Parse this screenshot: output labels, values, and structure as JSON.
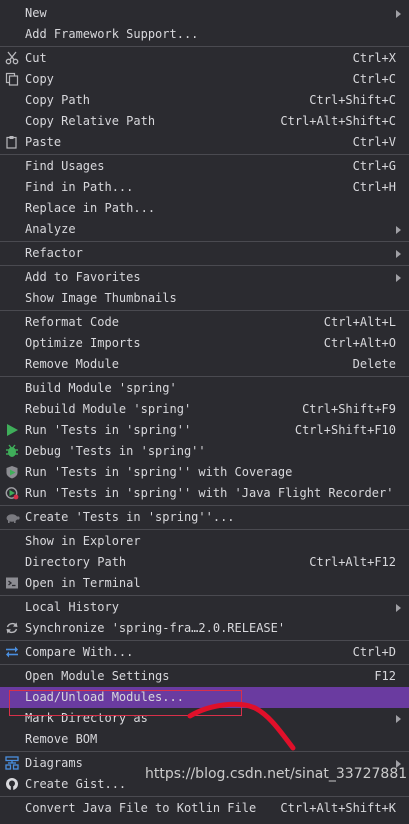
{
  "menu": {
    "new": {
      "label": "New"
    },
    "add_framework": {
      "label": "Add Framework Support..."
    },
    "cut": {
      "label": "Cut",
      "shortcut": "Ctrl+X"
    },
    "copy": {
      "label": "Copy",
      "shortcut": "Ctrl+C"
    },
    "copy_path": {
      "label": "Copy Path",
      "shortcut": "Ctrl+Shift+C"
    },
    "copy_relative_path": {
      "label": "Copy Relative Path",
      "shortcut": "Ctrl+Alt+Shift+C"
    },
    "paste": {
      "label": "Paste",
      "shortcut": "Ctrl+V"
    },
    "find_usages": {
      "label": "Find Usages",
      "shortcut": "Ctrl+G"
    },
    "find_in_path": {
      "label": "Find in Path...",
      "shortcut": "Ctrl+H"
    },
    "replace_in_path": {
      "label": "Replace in Path..."
    },
    "analyze": {
      "label": "Analyze"
    },
    "refactor": {
      "label": "Refactor"
    },
    "add_to_favorites": {
      "label": "Add to Favorites"
    },
    "show_thumbnails": {
      "label": "Show Image Thumbnails"
    },
    "reformat_code": {
      "label": "Reformat Code",
      "shortcut": "Ctrl+Alt+L"
    },
    "optimize_imports": {
      "label": "Optimize Imports",
      "shortcut": "Ctrl+Alt+O"
    },
    "remove_module": {
      "label": "Remove Module",
      "shortcut": "Delete"
    },
    "build_module": {
      "label": "Build Module 'spring'"
    },
    "rebuild_module": {
      "label": "Rebuild Module 'spring'",
      "shortcut": "Ctrl+Shift+F9"
    },
    "run_tests": {
      "label": "Run 'Tests in 'spring''",
      "shortcut": "Ctrl+Shift+F10"
    },
    "debug_tests": {
      "label": "Debug 'Tests in 'spring''"
    },
    "run_coverage": {
      "label": "Run 'Tests in 'spring'' with Coverage"
    },
    "run_jfr": {
      "label": "Run 'Tests in 'spring'' with 'Java Flight Recorder'"
    },
    "create_tests": {
      "label": "Create 'Tests in 'spring''..."
    },
    "show_in_explorer": {
      "label": "Show in Explorer"
    },
    "directory_path": {
      "label": "Directory Path",
      "shortcut": "Ctrl+Alt+F12"
    },
    "open_terminal": {
      "label": "Open in Terminal"
    },
    "local_history": {
      "label": "Local History"
    },
    "synchronize": {
      "label": "Synchronize 'spring-fra…2.0.RELEASE'"
    },
    "compare_with": {
      "label": "Compare With...",
      "shortcut": "Ctrl+D"
    },
    "open_module_settings": {
      "label": "Open Module Settings",
      "shortcut": "F12"
    },
    "load_unload_modules": {
      "label": "Load/Unload Modules..."
    },
    "mark_directory_as": {
      "label": "Mark Directory as"
    },
    "remove_bom": {
      "label": "Remove BOM"
    },
    "diagrams": {
      "label": "Diagrams"
    },
    "create_gist": {
      "label": "Create Gist..."
    },
    "convert_java": {
      "label": "Convert Java File to Kotlin File",
      "shortcut": "Ctrl+Alt+Shift+K"
    }
  },
  "watermark": {
    "text": "https://blog.csdn.net/sinat_33727881"
  },
  "colors": {
    "background": "#2b2b30",
    "highlight": "#6a3ba0",
    "annotation": "#d8304a",
    "separator": "#4a4a50"
  },
  "icons": {
    "cut": "scissors-icon",
    "copy": "copy-icon",
    "paste": "paste-icon",
    "run": "run-icon",
    "debug": "debug-icon",
    "coverage": "coverage-icon",
    "jfr": "flight-recorder-icon",
    "create_tests": "turtle-icon",
    "terminal": "terminal-icon",
    "sync": "sync-icon",
    "compare": "compare-icon",
    "diagrams": "diagram-icon",
    "gist": "github-icon"
  }
}
